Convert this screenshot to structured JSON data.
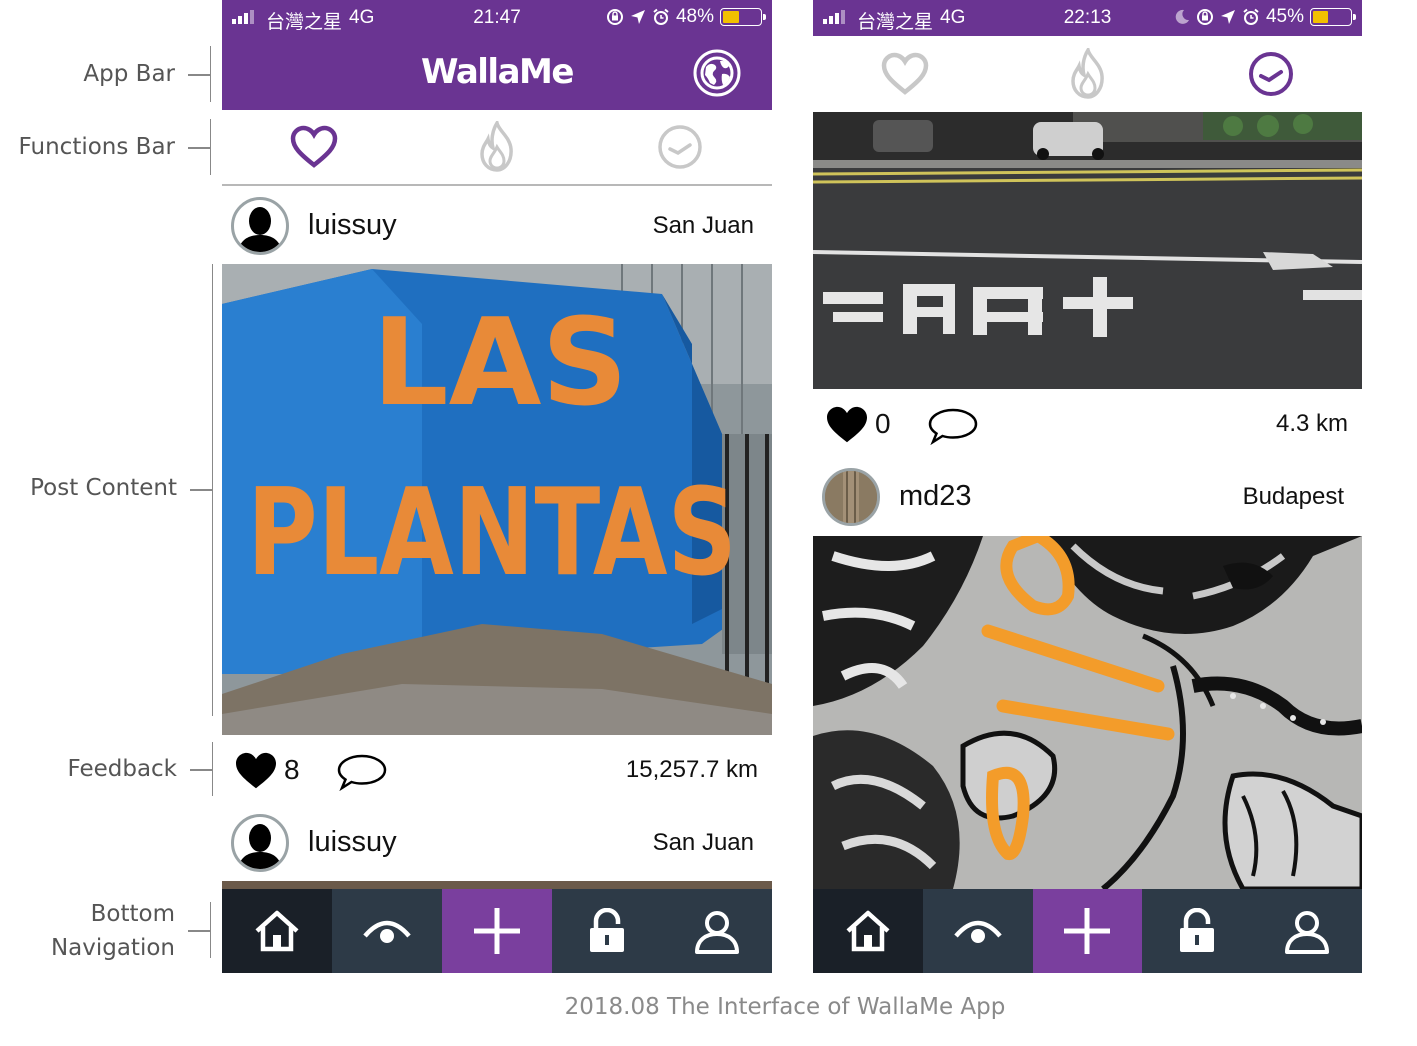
{
  "annotations": {
    "app_bar": "App Bar",
    "functions_bar": "Functions Bar",
    "post_content": "Post Content",
    "feedback": "Feedback",
    "bottom_navigation_line1": "Bottom",
    "bottom_navigation_line2": "Navigation"
  },
  "caption": "2018.08 The Interface of WallaMe App",
  "brand_color": "#6a3492",
  "left_phone": {
    "status": {
      "carrier": "台灣之星",
      "network": "4G",
      "time": "21:47",
      "battery": "48%",
      "battery_level": 0.48
    },
    "app_title": "WallaMe",
    "app_bar_icon": "globe-icon",
    "functions": [
      "heart-icon",
      "flame-icon",
      "clock-icon"
    ],
    "active_function": "heart-icon",
    "post1": {
      "username": "luissuy",
      "location": "San Juan",
      "photo_text_line1": "LAS",
      "photo_text_line2": "PLANTAS",
      "likes": "8",
      "distance": "15,257.7 km"
    },
    "post2": {
      "username": "luissuy",
      "location": "San Juan"
    }
  },
  "right_phone": {
    "status": {
      "carrier": "台灣之星",
      "network": "4G",
      "time": "22:13",
      "battery": "45%",
      "battery_level": 0.45
    },
    "functions": [
      "heart-icon",
      "flame-icon",
      "clock-icon"
    ],
    "active_function": "clock-icon",
    "post1": {
      "likes": "0",
      "distance": "4.3 km"
    },
    "post2": {
      "username": "md23",
      "location": "Budapest"
    }
  },
  "bottom_nav": [
    "home-icon",
    "eye-icon",
    "plus-icon",
    "lock-icon",
    "user-icon"
  ]
}
